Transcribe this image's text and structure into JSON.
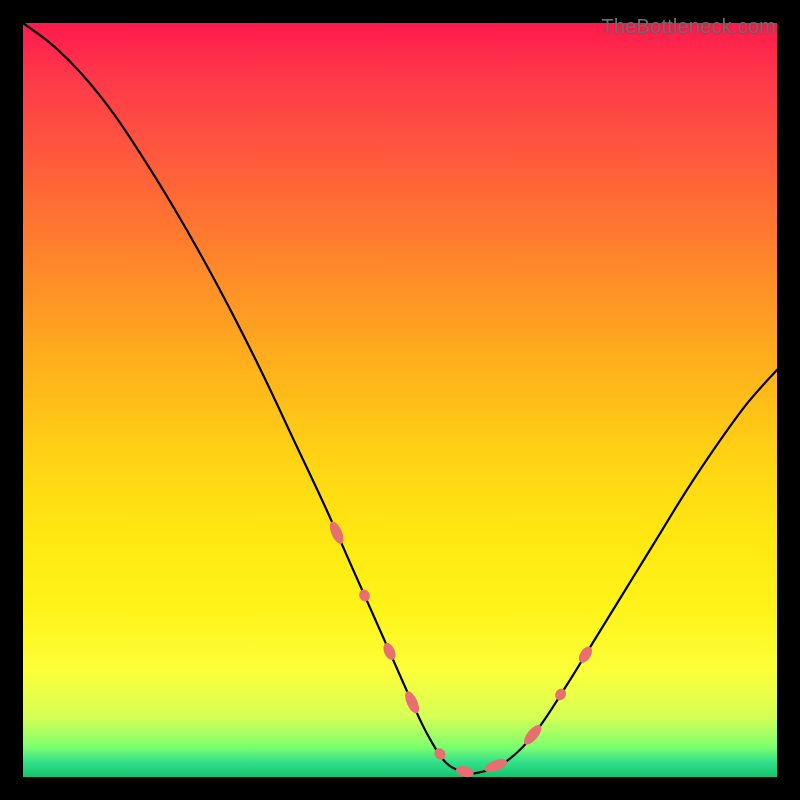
{
  "watermark": "TheBottleneck.com",
  "chart_data": {
    "type": "line",
    "title": "",
    "xlabel": "",
    "ylabel": "",
    "xlim": [
      0,
      100
    ],
    "ylim": [
      0,
      100
    ],
    "grid": false,
    "series": [
      {
        "name": "bottleneck-curve",
        "x": [
          0,
          4,
          8,
          12,
          16,
          20,
          24,
          28,
          32,
          36,
          40,
          44,
          48,
          52,
          54,
          56,
          58,
          60,
          64,
          68,
          72,
          76,
          80,
          84,
          88,
          92,
          96,
          100
        ],
        "values": [
          100,
          97,
          93,
          88,
          82,
          75.5,
          68.5,
          61,
          53,
          44.5,
          36,
          27,
          18,
          9,
          5,
          2,
          0.8,
          0.5,
          2,
          6,
          12,
          18.5,
          25,
          31.5,
          38,
          44,
          49.5,
          54
        ]
      }
    ],
    "highlight_segments": [
      {
        "name": "left-slope",
        "x_range": [
          40,
          48
        ],
        "value_range": [
          36,
          18
        ]
      },
      {
        "name": "valley",
        "x_range": [
          50,
          62
        ],
        "value_range": [
          12,
          0.5
        ]
      },
      {
        "name": "right-slope",
        "x_range": [
          66,
          76
        ],
        "value_range": [
          4,
          19
        ]
      }
    ],
    "colors": {
      "curve": "#000000",
      "highlight": "#e76f6f",
      "gradient_top": "#ff1a4d",
      "gradient_bottom": "#15c46f"
    }
  }
}
